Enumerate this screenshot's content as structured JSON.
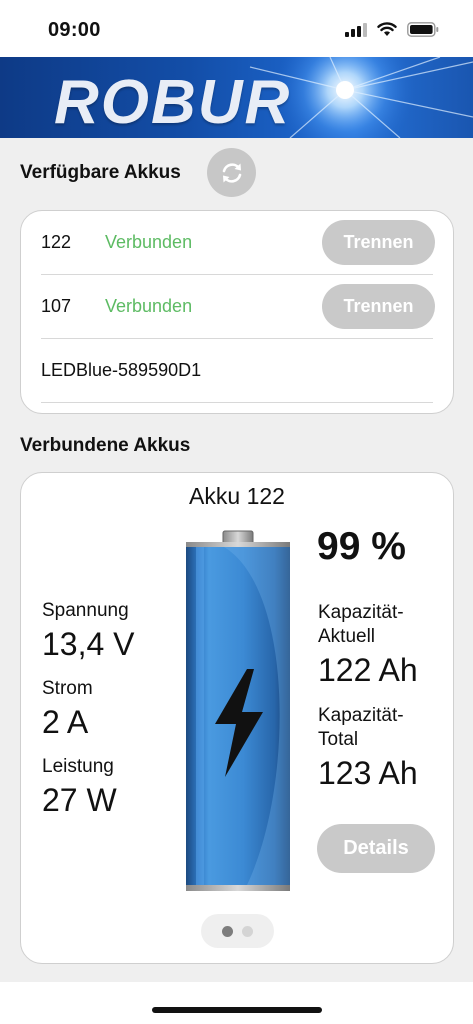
{
  "status_bar": {
    "time": "09:00",
    "icons": [
      "signal-icon",
      "wifi-icon",
      "battery-icon"
    ]
  },
  "banner": {
    "logo_text": "ROBUR"
  },
  "available": {
    "title": "Verfügbare Akkus",
    "refresh_icon": "refresh-icon",
    "items": [
      {
        "id": "122",
        "status": "Verbunden",
        "button": "Trennen"
      },
      {
        "id": "107",
        "status": "Verbunden",
        "button": "Trennen"
      },
      {
        "name": "LEDBlue-589590D1"
      }
    ]
  },
  "connected": {
    "title": "Verbundene Akkus",
    "akku_title": "Akku 122",
    "percent": "99 %",
    "spannung_label": "Spannung",
    "spannung_value": "13,4 V",
    "strom_label": "Strom",
    "strom_value": "2 A",
    "leistung_label": "Leistung",
    "leistung_value": "27 W",
    "kap_aktuell_label_1": "Kapazität-",
    "kap_aktuell_label_2": "Aktuell",
    "kap_aktuell_value": "122 Ah",
    "kap_total_label_1": "Kapazität-",
    "kap_total_label_2": "Total",
    "kap_total_value": "123 Ah",
    "details_button": "Details",
    "page_count": 2,
    "current_page": 1
  },
  "colors": {
    "connected_green": "#5dbb63",
    "button_gray": "#c9c9c9",
    "banner_blue": "#134ea8",
    "battery_blue": "#3f8ed6"
  }
}
